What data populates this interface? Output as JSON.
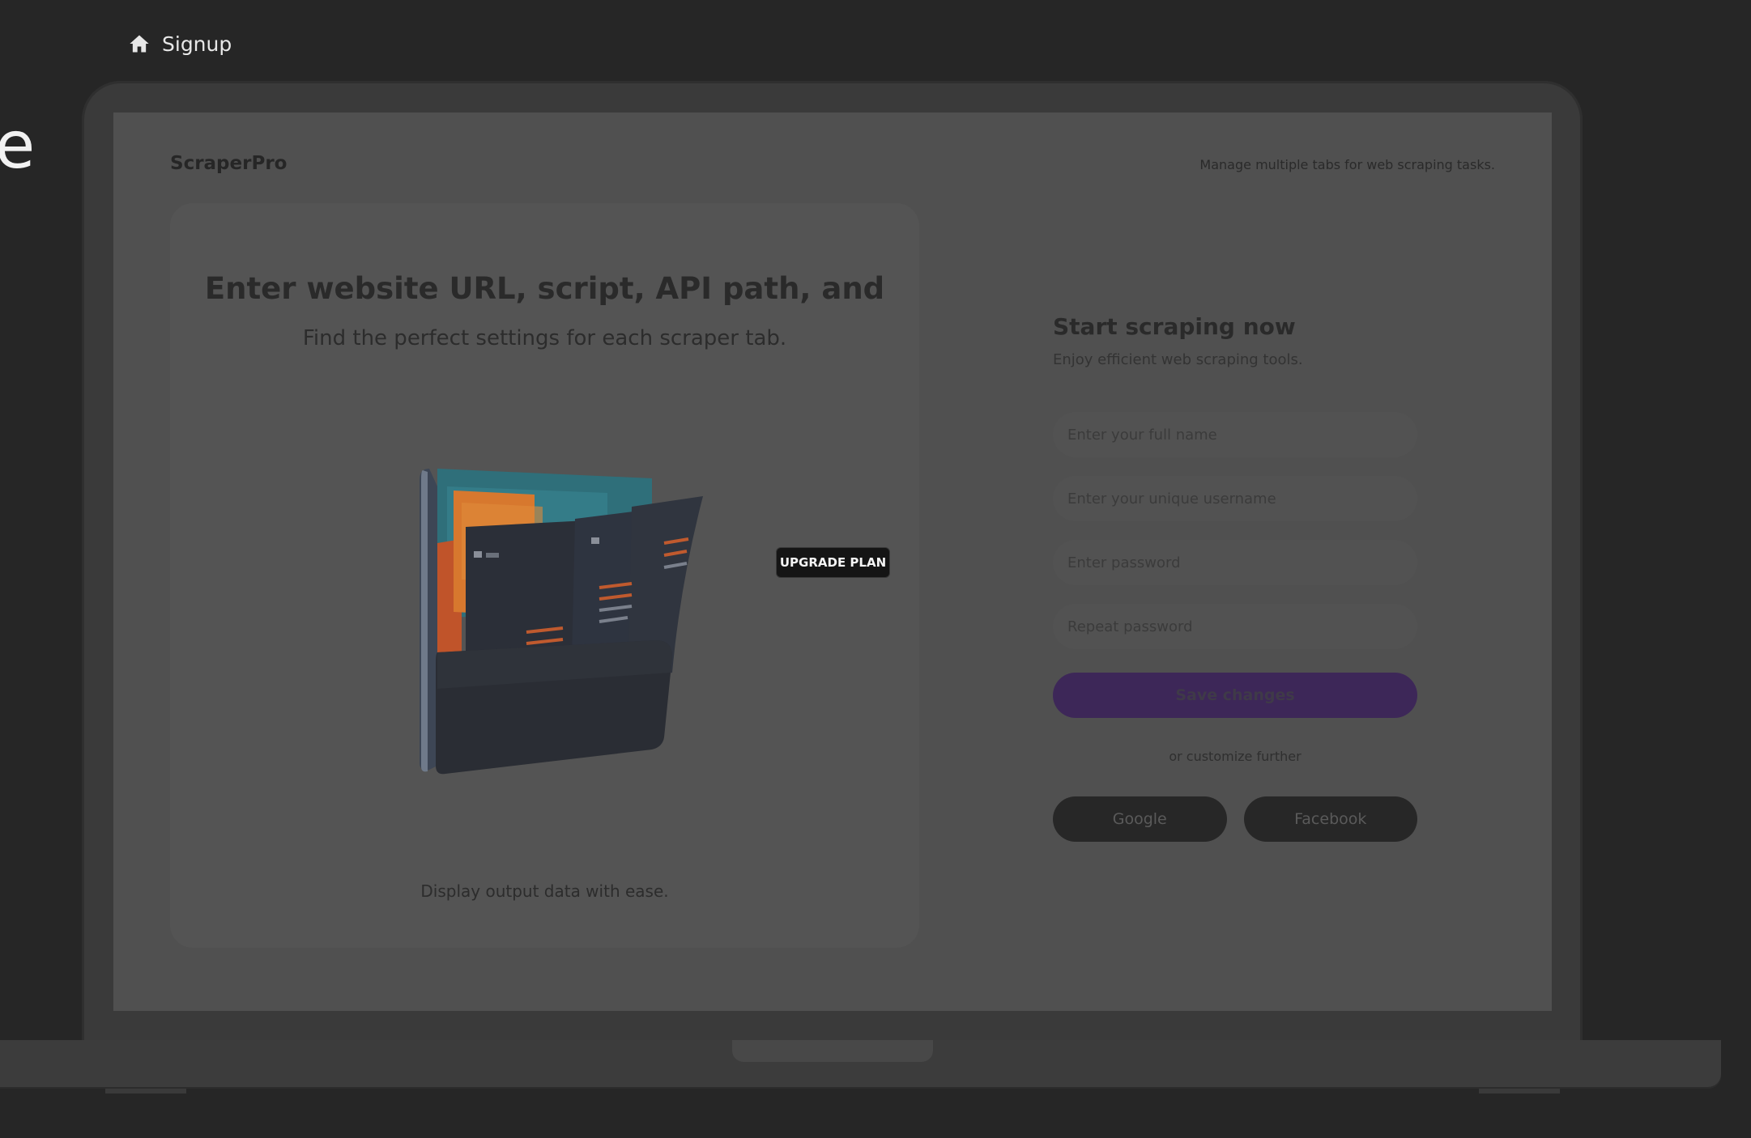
{
  "breadcrumb": {
    "label": "Signup",
    "icon": "home-icon"
  },
  "edge_text": "e",
  "app": {
    "brand": "ScraperPro",
    "tagline": "Manage multiple tabs for web scraping tasks."
  },
  "hero": {
    "title": "Enter website URL, script, API path, and",
    "subtitle": "Find the perfect settings for each scraper tab.",
    "caption": "Display output data with ease."
  },
  "upgrade": {
    "label": "UPGRADE PLAN"
  },
  "form": {
    "title": "Start scraping now",
    "subtitle": "Enjoy efficient web scraping tools.",
    "full_name_placeholder": "Enter your full name",
    "username_placeholder": "Enter your unique username",
    "password_placeholder": "Enter password",
    "repeat_password_placeholder": "Repeat password",
    "save_label": "Save changes",
    "divider_text": "or customize further",
    "google_label": "Google",
    "facebook_label": "Facebook"
  },
  "colors": {
    "page_bg": "#262626",
    "screen_bg": "#505050",
    "primary_button": "#3d2758",
    "social_button": "#272727"
  }
}
